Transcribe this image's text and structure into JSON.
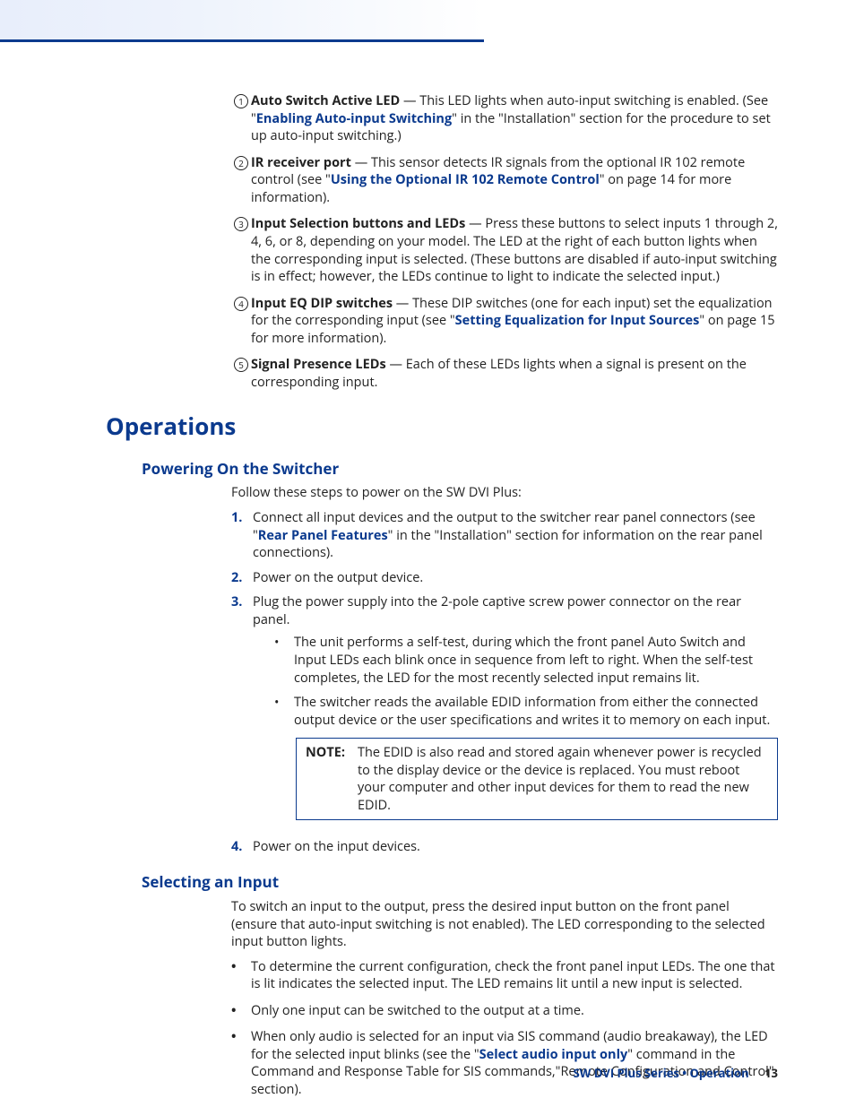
{
  "callouts": [
    {
      "num": "1",
      "title": "Auto Switch Active LED",
      "pre": " — This LED lights when auto-input switching is enabled. (See \"",
      "link": "Enabling Auto-input Switching",
      "post": "\" in the \"Installation\" section for the procedure to set up auto-input switching.)"
    },
    {
      "num": "2",
      "title": "IR receiver port",
      "pre": " — This sensor detects IR signals from the optional IR 102 remote control (see \"",
      "link": "Using the Optional IR 102 Remote Control",
      "post": "\" on page 14 for more information)."
    },
    {
      "num": "3",
      "title": "Input Selection buttons and LEDs",
      "pre": " — Press these buttons to select inputs 1 through 2, 4, 6, or 8, depending on your model. The LED at the right of each button lights when the corresponding input is selected. (These buttons are disabled if auto-input switching is in effect; however, the LEDs continue to light to indicate the selected input.)",
      "link": "",
      "post": ""
    },
    {
      "num": "4",
      "title": "Input EQ DIP switches",
      "pre": " — These DIP switches (one for each input) set the equalization for the corresponding input (see \"",
      "link": "Setting Equalization for Input Sources",
      "post": "\" on page 15 for more information)."
    },
    {
      "num": "5",
      "title": "Signal Presence LEDs",
      "pre": " — Each of these LEDs lights when a signal is present on the corresponding input.",
      "link": "",
      "post": ""
    }
  ],
  "h1": "Operations",
  "powering": {
    "heading": "Powering On the Switcher",
    "intro": "Follow these steps to power on the SW DVI Plus:",
    "steps": {
      "s1_pre": "Connect all input devices and the output to the switcher rear panel connectors (see \"",
      "s1_link": "Rear Panel Features",
      "s1_post": "\" in the \"Installation\" section for information on the rear panel connections).",
      "s2": "Power on the output device.",
      "s3": "Plug the power supply into the 2-pole captive screw power connector on the rear panel.",
      "s3_b1": "The unit performs a self-test, during which the front panel Auto Switch and Input LEDs each blink once in sequence from left to right. When the self-test completes, the LED for the most recently selected input remains lit.",
      "s3_b2": "The switcher reads the available EDID information from either the connected output device or the user specifications and writes it to memory on each input.",
      "note_label": "NOTE:",
      "note_body": "The EDID is also read and stored again whenever power is recycled to the display device or the device is replaced. You must reboot your computer and other input devices for them to read the new EDID.",
      "s4": "Power on the input devices."
    }
  },
  "selecting": {
    "heading": "Selecting an Input",
    "intro": "To switch an input to the output, press the desired input button on the front panel (ensure that auto-input switching is not enabled). The LED corresponding to the selected input button lights.",
    "b1": "To determine the current configuration, check the front panel input LEDs. The one that is lit indicates the selected input. The LED remains lit until a new input is selected.",
    "b2": "Only one input can be switched to the output at a time.",
    "b3_pre": "When only audio is selected for an input via SIS command (audio breakaway), the LED for the selected input blinks (see the \"",
    "b3_link": "Select audio input only",
    "b3_post": "\" command in the Command and Response Table for SIS commands,\"Remote Configuration and Control\" section)."
  },
  "footer": {
    "title": "SW DVI Plus Series • Operation",
    "page": "13"
  }
}
